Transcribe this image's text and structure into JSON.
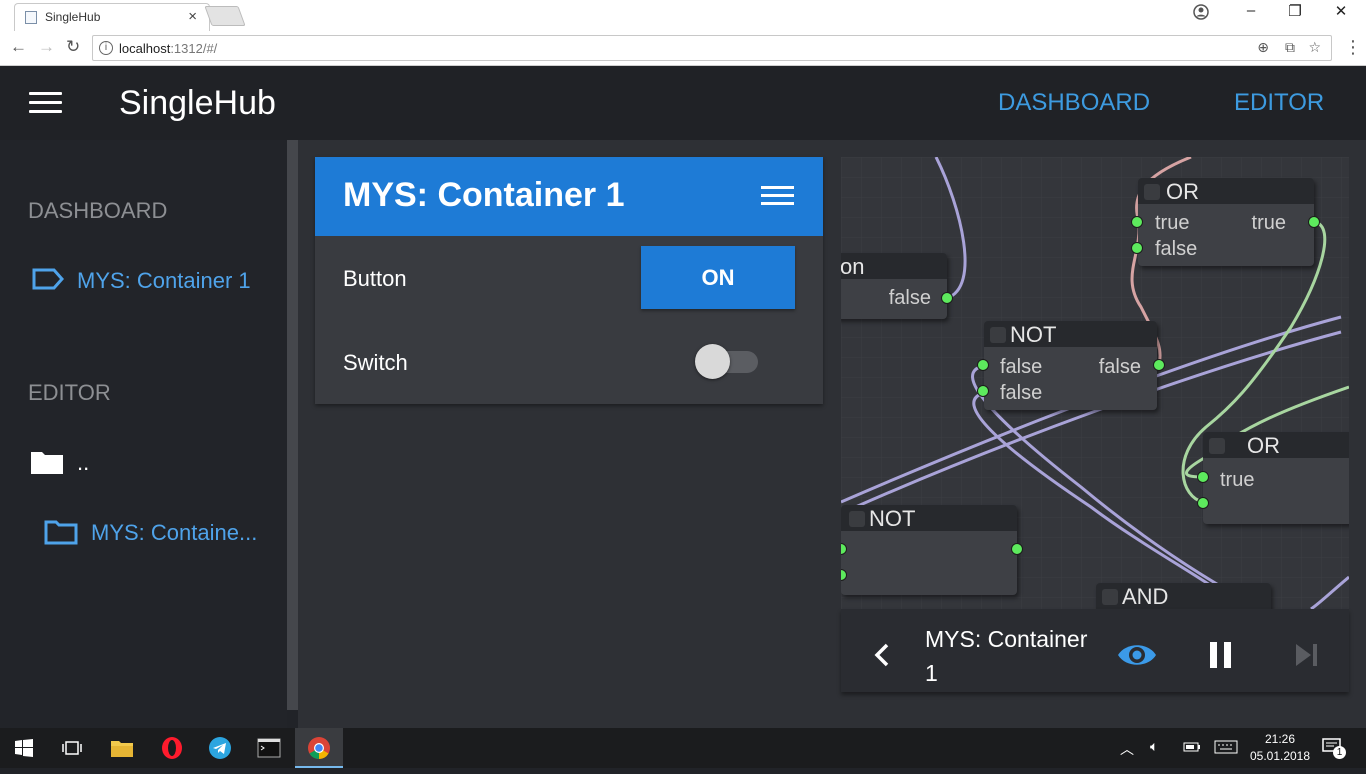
{
  "browser": {
    "tab_title": "SingleHub",
    "url_host": "localhost",
    "url_rest": ":1312/#/"
  },
  "app": {
    "brand": "SingleHub",
    "nav": [
      "DASHBOARD",
      "EDITOR"
    ]
  },
  "sidebar": {
    "dashboard_heading": "DASHBOARD",
    "dashboard_item": "MYS: Container 1",
    "editor_heading": "EDITOR",
    "folder_up": "..",
    "folder_item": "MYS: Containe..."
  },
  "card": {
    "title": "MYS: Container 1",
    "button_label": "Button",
    "button_value": "ON",
    "switch_label": "Switch",
    "switch_on": false
  },
  "editor": {
    "title": "MYS: Container 1",
    "nodes": {
      "or1": {
        "title": "OR",
        "in1": "true",
        "in2": "false",
        "out": "true"
      },
      "partial": {
        "title": "on",
        "out": "false"
      },
      "not1": {
        "title": "NOT",
        "in1": "false",
        "in2": "false",
        "out": "false"
      },
      "or2": {
        "title": "OR",
        "in1": "true"
      },
      "not2": {
        "title": "NOT"
      },
      "and": {
        "title": "AND"
      }
    }
  },
  "taskbar": {
    "time": "21:26",
    "date": "05.01.2018",
    "notifications": "1"
  },
  "colors": {
    "accent": "#1e7bd6",
    "link": "#4fa3ea",
    "pin": "#5dea5d"
  }
}
